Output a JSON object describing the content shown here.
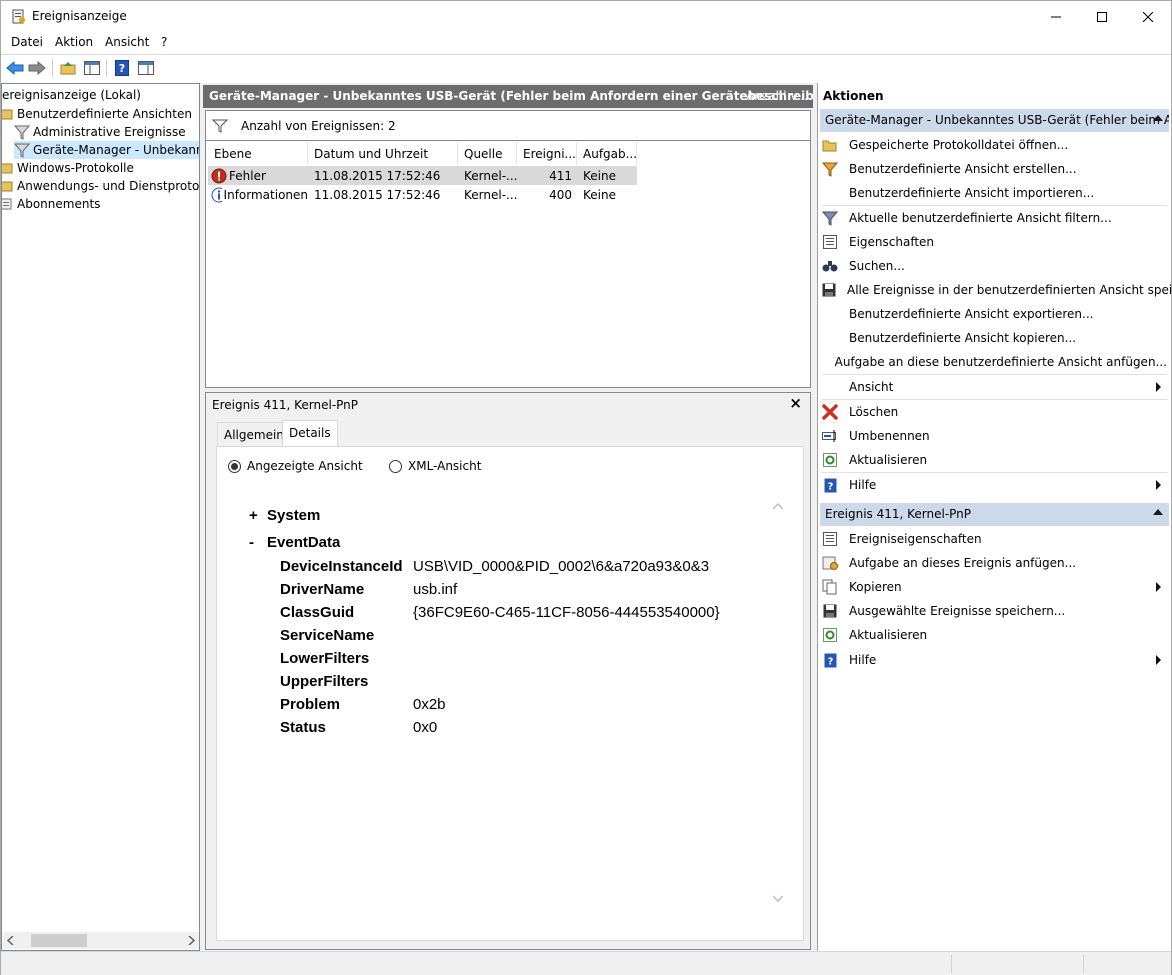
{
  "window": {
    "title": "Ereignisanzeige",
    "controls": {
      "minimize": "—",
      "maximize": "☐",
      "close": "✕"
    }
  },
  "menu": [
    "Datei",
    "Aktion",
    "Ansicht",
    "?"
  ],
  "toolbar": {
    "icons": [
      "back-arrow-icon",
      "forward-arrow-icon",
      "folder-up-icon",
      "show-hide-tree-icon",
      "help-icon",
      "show-hide-action-pane-icon"
    ]
  },
  "tree": {
    "items": [
      {
        "label": "ereignisanzeige (Lokal)",
        "icon": "event-viewer-icon"
      },
      {
        "label": "Benutzerdefinierte Ansichten",
        "icon": "folder-icon"
      },
      {
        "label": "Administrative Ereignisse",
        "icon": "filter-icon"
      },
      {
        "label": "Geräte-Manager - Unbekanntes",
        "icon": "filter-icon",
        "selected": true
      },
      {
        "label": "Windows-Protokolle",
        "icon": "folder-icon"
      },
      {
        "label": "Anwendungs- und Dienstprotokolle",
        "icon": "folder-icon"
      },
      {
        "label": "Abonnements",
        "icon": "subscription-icon"
      }
    ]
  },
  "middle": {
    "header": "Geräte-Manager - Unbekanntes USB-Gerät (Fehler beim Anfordern einer Gerätebeschreibung.)",
    "header_extra": "Anzahl v...",
    "filter_count": "Anzahl von Ereignissen: 2",
    "columns": [
      "Ebene",
      "Datum und Uhrzeit",
      "Quelle",
      "Ereigni...",
      "Aufgab..."
    ],
    "rows": [
      {
        "level": "Fehler",
        "level_icon": "error-icon",
        "date": "11.08.2015 17:52:46",
        "source": "Kernel-...",
        "id": "411",
        "task": "Keine",
        "selected": true
      },
      {
        "level": "Informationen",
        "level_icon": "info-icon",
        "date": "11.08.2015 17:52:46",
        "source": "Kernel-...",
        "id": "400",
        "task": "Keine",
        "selected": false
      }
    ]
  },
  "detail": {
    "title": "Ereignis 411, Kernel-PnP",
    "close": "×",
    "tabs": [
      "Allgemein",
      "Details"
    ],
    "active_tab": "Details",
    "radio_friendly": "Angezeigte Ansicht",
    "radio_xml": "XML-Ansicht",
    "selected_radio": "Angezeigte Ansicht",
    "system_toggle": "+",
    "system_label": "System",
    "eventdata_toggle": "-",
    "eventdata_label": "EventData",
    "fields": [
      {
        "key": "DeviceInstanceId",
        "value": "USB\\VID_0000&PID_0002\\6&a720a93&0&3"
      },
      {
        "key": "DriverName",
        "value": "usb.inf"
      },
      {
        "key": "ClassGuid",
        "value": "{36FC9E60-C465-11CF-8056-444553540000}"
      },
      {
        "key": "ServiceName",
        "value": ""
      },
      {
        "key": "LowerFilters",
        "value": ""
      },
      {
        "key": "UpperFilters",
        "value": ""
      },
      {
        "key": "Problem",
        "value": "0x2b"
      },
      {
        "key": "Status",
        "value": "0x0"
      }
    ]
  },
  "actions": {
    "title": "Aktionen",
    "section1": "Geräte-Manager - Unbekanntes USB-Gerät (Fehler beim An...",
    "items1": [
      {
        "label": "Gespeicherte Protokolldatei öffnen...",
        "icon": "open-folder-icon"
      },
      {
        "label": "Benutzerdefinierte Ansicht erstellen...",
        "icon": "filter-create-icon"
      },
      {
        "label": "Benutzerdefinierte Ansicht importieren...",
        "icon": ""
      },
      {
        "label": "Aktuelle benutzerdefinierte Ansicht filtern...",
        "icon": "filter-icon"
      },
      {
        "label": "Eigenschaften",
        "icon": "properties-icon"
      },
      {
        "label": "Suchen...",
        "icon": "binoculars-icon"
      },
      {
        "label": "Alle Ereignisse in der benutzerdefinierten Ansicht speic...",
        "icon": "save-icon"
      },
      {
        "label": "Benutzerdefinierte Ansicht exportieren...",
        "icon": ""
      },
      {
        "label": "Benutzerdefinierte Ansicht kopieren...",
        "icon": ""
      },
      {
        "label": "Aufgabe an diese benutzerdefinierte Ansicht anfügen...",
        "icon": ""
      },
      {
        "label": "Ansicht",
        "icon": "",
        "submenu": true
      },
      {
        "label": "Löschen",
        "icon": "delete-icon"
      },
      {
        "label": "Umbenennen",
        "icon": "rename-icon"
      },
      {
        "label": "Aktualisieren",
        "icon": "refresh-icon"
      },
      {
        "label": "Hilfe",
        "icon": "help-icon",
        "submenu": true
      }
    ],
    "section2": "Ereignis 411, Kernel-PnP",
    "items2": [
      {
        "label": "Ereigniseigenschaften",
        "icon": "event-properties-icon"
      },
      {
        "label": "Aufgabe an dieses Ereignis anfügen...",
        "icon": "task-icon"
      },
      {
        "label": "Kopieren",
        "icon": "copy-icon",
        "submenu": true
      },
      {
        "label": "Ausgewählte Ereignisse speichern...",
        "icon": "save-icon"
      },
      {
        "label": "Aktualisieren",
        "icon": "refresh-icon"
      },
      {
        "label": "Hilfe",
        "icon": "help-icon",
        "submenu": true
      }
    ]
  }
}
